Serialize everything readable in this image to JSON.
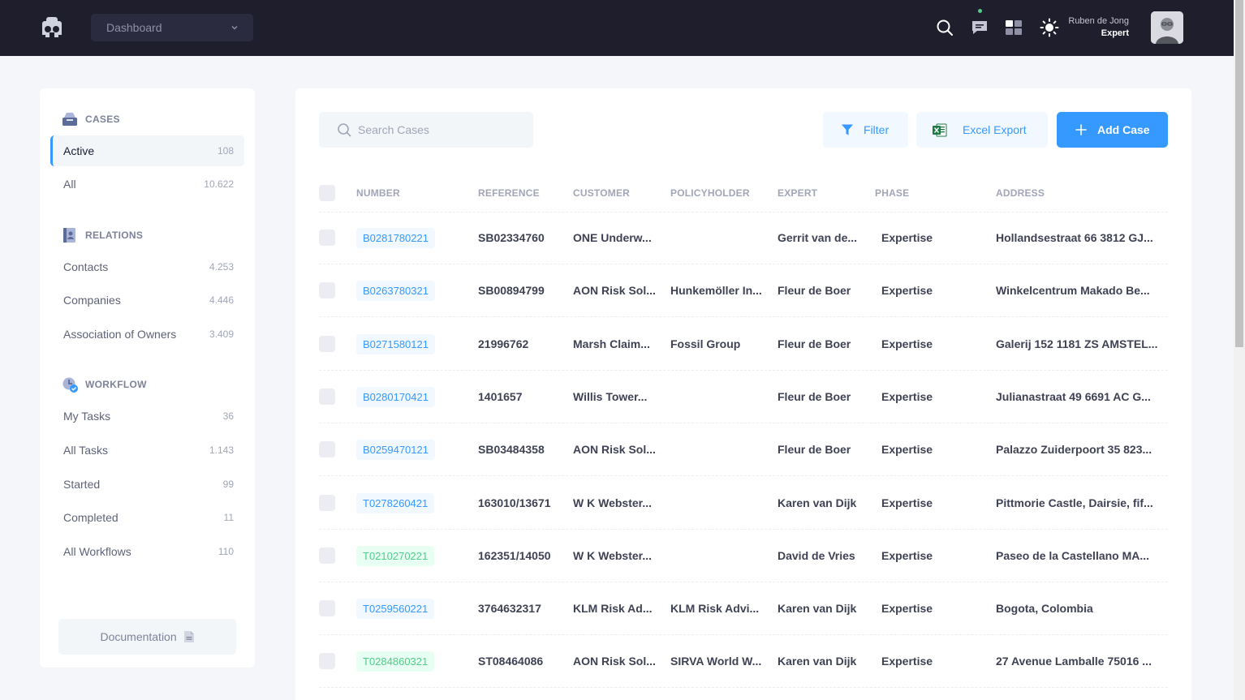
{
  "header": {
    "dashboard_select": "Dashboard",
    "user_name": "Ruben de Jong",
    "user_role": "Expert"
  },
  "sidebar": {
    "cases_title": "CASES",
    "relations_title": "RELATIONS",
    "workflow_title": "WORKFLOW",
    "cases": [
      {
        "label": "Active",
        "count": "108"
      },
      {
        "label": "All",
        "count": "10.622"
      }
    ],
    "relations": [
      {
        "label": "Contacts",
        "count": "4.253"
      },
      {
        "label": "Companies",
        "count": "4.446"
      },
      {
        "label": "Association of Owners",
        "count": "3.409"
      }
    ],
    "workflow": [
      {
        "label": "My Tasks",
        "count": "36"
      },
      {
        "label": "All Tasks",
        "count": "1.143"
      },
      {
        "label": "Started",
        "count": "99"
      },
      {
        "label": "Completed",
        "count": "11"
      },
      {
        "label": "All Workflows",
        "count": "110"
      }
    ],
    "documentation": "Documentation"
  },
  "toolbar": {
    "search_placeholder": "Search Cases",
    "filter_label": "Filter",
    "excel_label": "Excel Export",
    "add_label": "Add Case"
  },
  "table": {
    "columns": [
      "NUMBER",
      "REFERENCE",
      "CUSTOMER",
      "POLICYHOLDER",
      "EXPERT",
      "PHASE",
      "ADDRESS"
    ],
    "rows": [
      {
        "number": "B0281780221",
        "reference": "SB02334760",
        "customer": "ONE Underw...",
        "policyholder": "",
        "expert": "Gerrit van de...",
        "phase": "Expertise",
        "address": "Hollandsestraat 66 3812 GJ..."
      },
      {
        "number": "B0263780321",
        "reference": "SB00894799",
        "customer": "AON Risk Sol...",
        "policyholder": "Hunkemöller In...",
        "expert": "Fleur de Boer",
        "phase": "Expertise",
        "address": "Winkelcentrum Makado Be..."
      },
      {
        "number": "B0271580121",
        "reference": "21996762",
        "customer": "Marsh Claim...",
        "policyholder": "Fossil Group",
        "expert": "Fleur de Boer",
        "phase": "Expertise",
        "address": "Galerij 152 1181 ZS AMSTEL..."
      },
      {
        "number": "B0280170421",
        "reference": "1401657",
        "customer": "Willis Tower...",
        "policyholder": "",
        "expert": "Fleur de Boer",
        "phase": "Expertise",
        "address": "Julianastraat 49 6691 AC G..."
      },
      {
        "number": "B0259470121",
        "reference": "SB03484358",
        "customer": "AON Risk Sol...",
        "policyholder": "",
        "expert": "Fleur de Boer",
        "phase": "Expertise",
        "address": "Palazzo Zuiderpoort 35 823..."
      },
      {
        "number": "T0278260421",
        "reference": "163010/13671",
        "customer": "W K Webster...",
        "policyholder": "",
        "expert": "Karen van Dijk",
        "phase": "Expertise",
        "address": "Pittmorie Castle, Dairsie, fif..."
      },
      {
        "number": "T0210270221",
        "reference": "162351/14050",
        "customer": "W K Webster...",
        "policyholder": "",
        "expert": "David de Vries",
        "phase": "Expertise",
        "address": "Paseo de la Castellano MA..."
      },
      {
        "number": "T0259560221",
        "reference": "3764632317",
        "customer": "KLM Risk Ad...",
        "policyholder": "KLM Risk Advi...",
        "expert": "Karen van Dijk",
        "phase": "Expertise",
        "address": "Bogota, Colombia"
      },
      {
        "number": "T0284860321",
        "reference": "ST08464086",
        "customer": "AON Risk Sol...",
        "policyholder": "SIRVA World W...",
        "expert": "Karen van Dijk",
        "phase": "Expertise",
        "address": "27 Avenue Lamballe 75016 ..."
      }
    ]
  },
  "colors": {
    "header_bg": "#1e1e2d",
    "primary": "#3699ff",
    "success": "#50cd89"
  }
}
